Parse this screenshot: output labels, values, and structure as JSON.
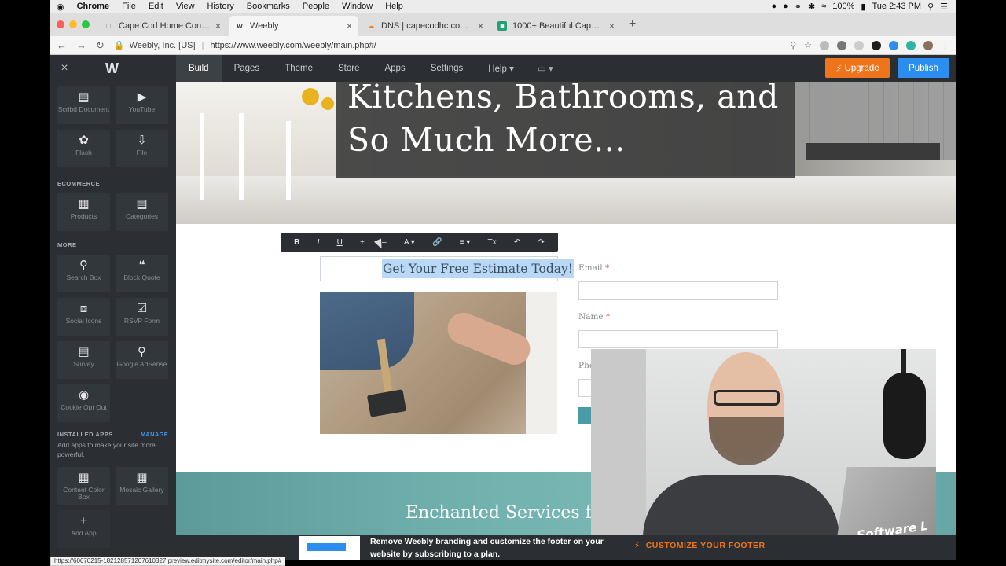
{
  "mac_menu": {
    "apple": "",
    "app_name": "Chrome",
    "items": [
      "File",
      "Edit",
      "View",
      "History",
      "Bookmarks",
      "People",
      "Window",
      "Help"
    ],
    "battery": "100%",
    "clock": "Tue 2:43 PM"
  },
  "browser": {
    "tabs": [
      {
        "label": "Cape Cod Home Construction",
        "active": false,
        "favicon": "page-icon"
      },
      {
        "label": "Weebly",
        "active": true,
        "favicon": "weebly-icon"
      },
      {
        "label": "DNS | capecodhc.com | Accou",
        "active": false,
        "favicon": "cloudflare-icon"
      },
      {
        "label": "1000+ Beautiful Cape Cod Hou",
        "active": false,
        "favicon": "unsplash-icon"
      }
    ],
    "site_identity": "Weebly, Inc. [US]",
    "url": "https://www.weebly.com/weebly/main.php#/",
    "status_url": "https://60670215-182128571207610327.preview.editmysite.com/editor/main.php#"
  },
  "weebly_nav": {
    "close_icon": "close-icon",
    "logo": "W",
    "tabs": [
      {
        "label": "Build",
        "active": true
      },
      {
        "label": "Pages",
        "active": false
      },
      {
        "label": "Theme",
        "active": false
      },
      {
        "label": "Store",
        "active": false
      },
      {
        "label": "Apps",
        "active": false
      },
      {
        "label": "Settings",
        "active": false
      },
      {
        "label": "Help ▾",
        "active": false
      }
    ],
    "upgrade_label": "Upgrade",
    "publish_label": "Publish",
    "accent_upgrade": "#f0741b",
    "accent_publish": "#2c8ff0"
  },
  "sidebar": {
    "media_items": [
      {
        "label": "Scribd Document",
        "icon": "document-icon"
      },
      {
        "label": "YouTube",
        "icon": "play-icon"
      },
      {
        "label": "Flash",
        "icon": "flash-icon"
      },
      {
        "label": "File",
        "icon": "file-icon"
      }
    ],
    "ecommerce_heading": "ECOMMERCE",
    "ecommerce_items": [
      {
        "label": "Products",
        "icon": "products-icon"
      },
      {
        "label": "Categories",
        "icon": "categories-icon"
      }
    ],
    "more_heading": "MORE",
    "more_items": [
      {
        "label": "Search Box",
        "icon": "search-icon"
      },
      {
        "label": "Block Quote",
        "icon": "quote-icon"
      },
      {
        "label": "Social Icons",
        "icon": "share-icon"
      },
      {
        "label": "RSVP Form",
        "icon": "rsvp-icon"
      },
      {
        "label": "Survey",
        "icon": "survey-icon"
      },
      {
        "label": "Google AdSense",
        "icon": "adsense-icon"
      },
      {
        "label": "Cookie Opt Out",
        "icon": "cookie-icon"
      }
    ],
    "installed_heading": "INSTALLED APPS",
    "manage_label": "MANAGE",
    "installed_note": "Add apps to make your site more powerful.",
    "installed_items": [
      {
        "label": "Content Color Box",
        "icon": "grid-icon"
      },
      {
        "label": "Mosaic Gallery",
        "icon": "mosaic-icon"
      }
    ],
    "add_app_label": "Add App"
  },
  "canvas": {
    "hero_title": "Kitchens, Bathrooms, and So Much More...",
    "toolbar_buttons": [
      {
        "label": "B",
        "name": "bold-button"
      },
      {
        "label": "I",
        "name": "italic-button"
      },
      {
        "label": "U",
        "name": "underline-button"
      },
      {
        "label": "+",
        "name": "font-size-up-button"
      },
      {
        "label": "–",
        "name": "font-size-down-button"
      },
      {
        "label": "A ▾",
        "name": "text-color-button"
      },
      {
        "label": "🔗",
        "name": "link-button"
      },
      {
        "label": "≡ ▾",
        "name": "align-button"
      },
      {
        "label": "Tx",
        "name": "clear-format-button"
      },
      {
        "label": "↶",
        "name": "undo-button"
      },
      {
        "label": "↷",
        "name": "redo-button"
      }
    ],
    "heading_text": "Get Your Free Estimate Today!",
    "form": {
      "email_label": "Email",
      "name_label": "Name",
      "phone_label_partial": "Pho",
      "required_mark": "*"
    },
    "band_title": "Enchanted Services for"
  },
  "promo": {
    "text": "Remove Weebly branding and customize the footer on your website by subscribing to a plan.",
    "cta": "CUSTOMIZE YOUR FOOTER"
  },
  "webcam": {
    "sticker_text": "Software L"
  }
}
